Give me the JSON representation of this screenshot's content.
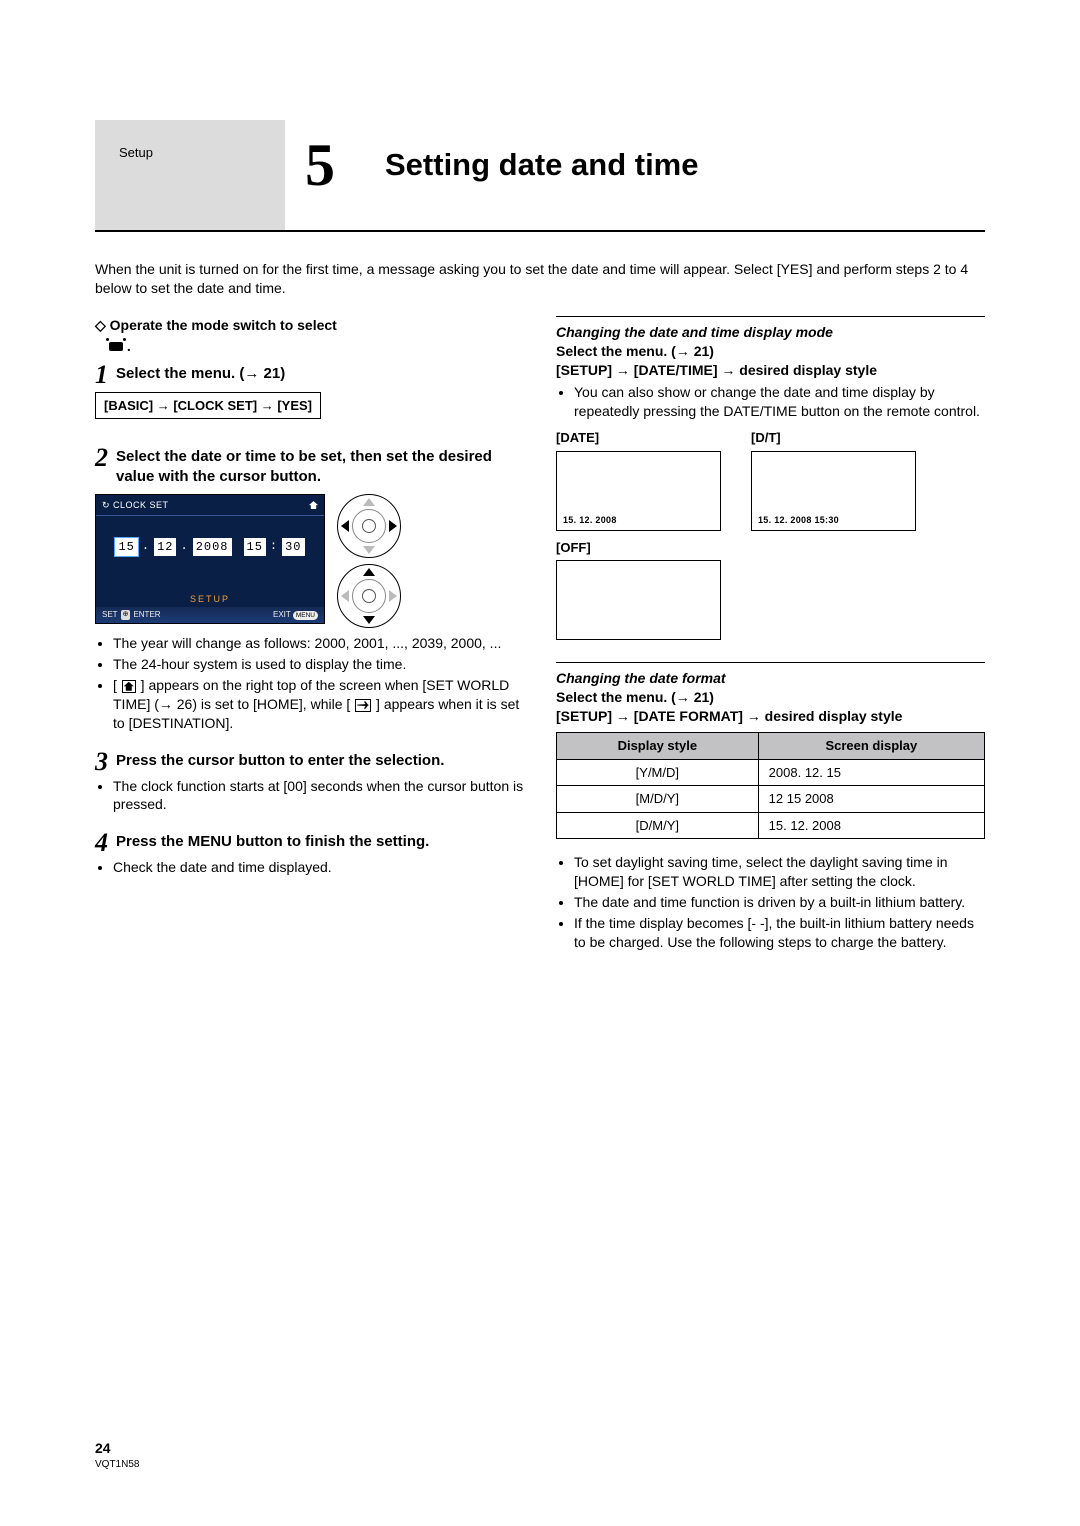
{
  "header": {
    "section_label": "Setup",
    "chapter_number": "5",
    "title": "Setting date and time"
  },
  "intro": "When the unit is turned on for the first time, a message asking you to set the date and time will appear. Select [YES] and perform steps 2 to 4 below to set the date and time.",
  "left": {
    "operate_line_1": "Operate the mode switch to select",
    "operate_line_2": ".",
    "step1_text": "Select the menu. (→ 21)",
    "menu_path": "[BASIC] → [CLOCK SET] → [YES]",
    "step2_text": "Select the date or time to be set, then set the desired value with the cursor button.",
    "screenshot": {
      "title": "CLOCK SET",
      "values": [
        "15",
        ".",
        "12",
        ".",
        "2008",
        "15",
        ":",
        "30"
      ],
      "setup_label": "SETUP",
      "footer_set": "SET",
      "footer_enter": "ENTER",
      "footer_exit": "EXIT",
      "footer_menu": "MENU"
    },
    "bullets2": [
      "The year will change as follows: 2000, 2001, ..., 2039, 2000, ...",
      "The 24-hour system is used to display the time.",
      "__icon_house__ appears on the right top of the screen when [SET WORLD TIME] (→ 26) is set to [HOME], while __icon_plane__ appears when it is set to [DESTINATION]."
    ],
    "step3_text": "Press the cursor button to enter the selection.",
    "bullets3": [
      "The clock function starts at [00] seconds when the cursor button is pressed."
    ],
    "step4_text": "Press the MENU button to finish the setting.",
    "bullets4": [
      "Check the date and time displayed."
    ]
  },
  "right": {
    "changeMode": {
      "heading": "Changing the date and time display mode",
      "select_menu": "Select the menu. (→ 21)",
      "path": "[SETUP] → [DATE/TIME] → desired display style",
      "note": "You can also show or change the date and time display by repeatedly pressing the DATE/TIME button on the remote control.",
      "previews": {
        "date_label": "[DATE]",
        "date_value": "15. 12. 2008",
        "dt_label": "[D/T]",
        "dt_value": "15. 12. 2008 15:30",
        "off_label": "[OFF]"
      }
    },
    "changeFormat": {
      "heading": "Changing the date format",
      "select_menu": "Select the menu. (→ 21)",
      "path": "[SETUP] → [DATE FORMAT] → desired display style",
      "table": {
        "headers": [
          "Display style",
          "Screen display"
        ],
        "rows": [
          [
            "[Y/M/D]",
            "2008. 12. 15"
          ],
          [
            "[M/D/Y]",
            "12 15 2008"
          ],
          [
            "[D/M/Y]",
            "15. 12. 2008"
          ]
        ]
      }
    },
    "final_bullets": [
      "To set daylight saving time, select the daylight saving time in [HOME] for [SET WORLD TIME] after setting the clock.",
      "The date and time function is driven by a built-in lithium battery.",
      "If the time display becomes [- -], the built-in lithium battery needs to be charged. Use the following steps to charge the battery."
    ]
  },
  "footer": {
    "page_number": "24",
    "doc_id": "VQT1N58"
  }
}
